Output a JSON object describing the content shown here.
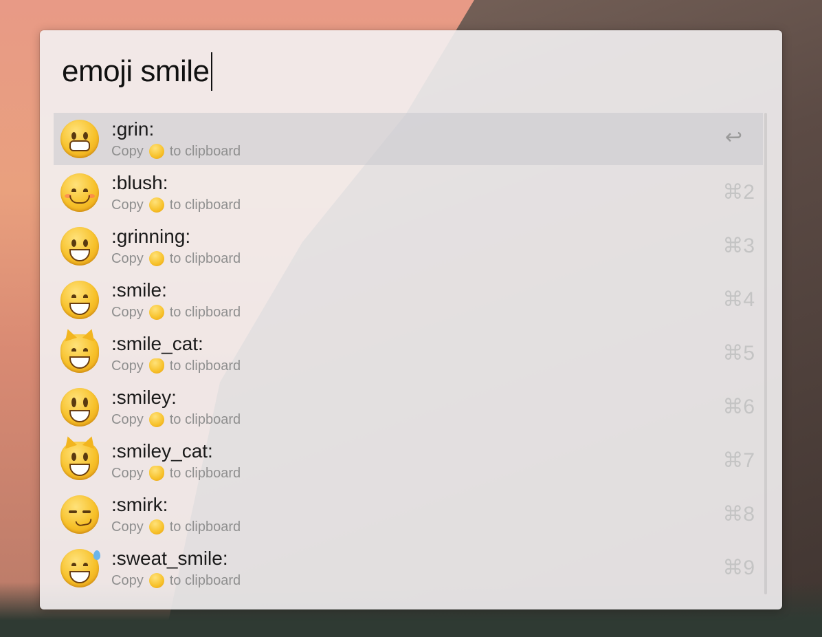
{
  "search": {
    "query": "emoji smile"
  },
  "results": [
    {
      "title": ":grin:",
      "copy": "Copy",
      "to_clipboard": "to clipboard",
      "shortcut": "↩",
      "icon": "grin-emoji-icon"
    },
    {
      "title": ":blush:",
      "copy": "Copy",
      "to_clipboard": "to clipboard",
      "shortcut": "⌘2",
      "icon": "blush-emoji-icon"
    },
    {
      "title": ":grinning:",
      "copy": "Copy",
      "to_clipboard": "to clipboard",
      "shortcut": "⌘3",
      "icon": "grinning-emoji-icon"
    },
    {
      "title": ":smile:",
      "copy": "Copy",
      "to_clipboard": "to clipboard",
      "shortcut": "⌘4",
      "icon": "smile-emoji-icon"
    },
    {
      "title": ":smile_cat:",
      "copy": "Copy",
      "to_clipboard": "to clipboard",
      "shortcut": "⌘5",
      "icon": "smile-cat-emoji-icon"
    },
    {
      "title": ":smiley:",
      "copy": "Copy",
      "to_clipboard": "to clipboard",
      "shortcut": "⌘6",
      "icon": "smiley-emoji-icon"
    },
    {
      "title": ":smiley_cat:",
      "copy": "Copy",
      "to_clipboard": "to clipboard",
      "shortcut": "⌘7",
      "icon": "smiley-cat-emoji-icon"
    },
    {
      "title": ":smirk:",
      "copy": "Copy",
      "to_clipboard": "to clipboard",
      "shortcut": "⌘8",
      "icon": "smirk-emoji-icon"
    },
    {
      "title": ":sweat_smile:",
      "copy": "Copy",
      "to_clipboard": "to clipboard",
      "shortcut": "⌘9",
      "icon": "sweat-smile-emoji-icon"
    }
  ],
  "colors": {
    "accent_selected_row": "#c8c8cd",
    "emoji_yellow": "#f7c12a",
    "muted_text": "#8f8f8f"
  }
}
